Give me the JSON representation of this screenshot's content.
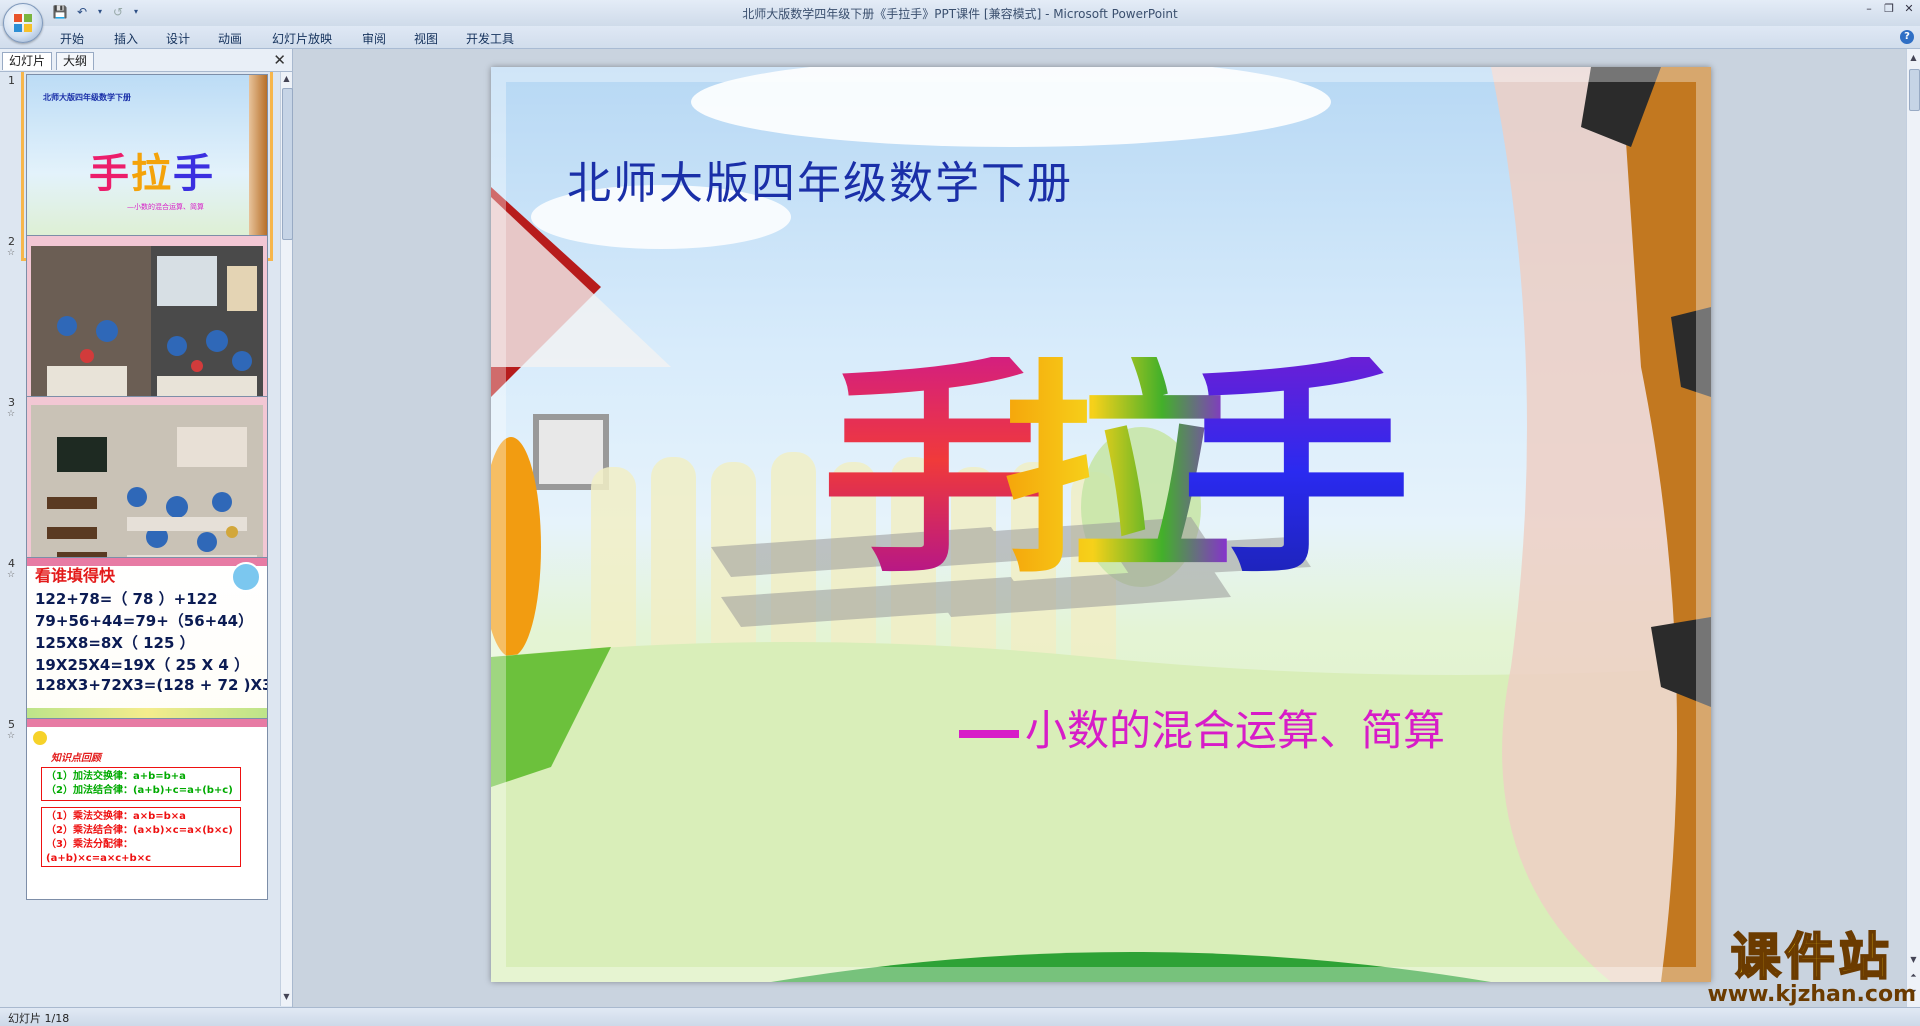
{
  "window": {
    "title": "北师大版数学四年级下册《手拉手》PPT课件 [兼容模式] - Microsoft PowerPoint"
  },
  "ribbon": {
    "tabs": [
      "开始",
      "插入",
      "设计",
      "动画",
      "幻灯片放映",
      "审阅",
      "视图",
      "开发工具"
    ]
  },
  "left_pane": {
    "tabs": [
      "幻灯片",
      "大纲"
    ],
    "thumbnails": [
      {
        "number": "1",
        "title": "北师大版四年级数学下册",
        "big": "手拉手",
        "subtitle": "—小数的混合运算、简算"
      },
      {
        "number": "2"
      },
      {
        "number": "3"
      },
      {
        "number": "4",
        "heading": "看谁填得快",
        "lines": [
          "122+78=（ 78 ）+122",
          "79+56+44=79+（56+44）",
          "125X8=8X（ 125 ）",
          "19X25X4=19X（ 25 X 4 ）",
          "128X3+72X3=(128 + 72 )X3"
        ]
      },
      {
        "number": "5",
        "heading": "知识点回顾",
        "box1": [
          "（1）加法交换律：a+b=b+a",
          "（2）加法结合律：(a+b)+c=a+(b+c)"
        ],
        "box2": [
          "（1）乘法交换律：a×b=b×a",
          "（2）乘法结合律：(a×b)×c=a×(b×c)",
          "（3）乘法分配律：(a+b)×c=a×c+b×c"
        ]
      }
    ]
  },
  "slide": {
    "title": "北师大版四年级数学下册",
    "chars": [
      "手",
      "拉",
      "手"
    ],
    "subtitle": "小数的混合运算、简算"
  },
  "watermark": {
    "text": "课件站",
    "url": "www.kjzhan.com"
  },
  "status": {
    "slide_indicator": "幻灯片 1/18"
  }
}
